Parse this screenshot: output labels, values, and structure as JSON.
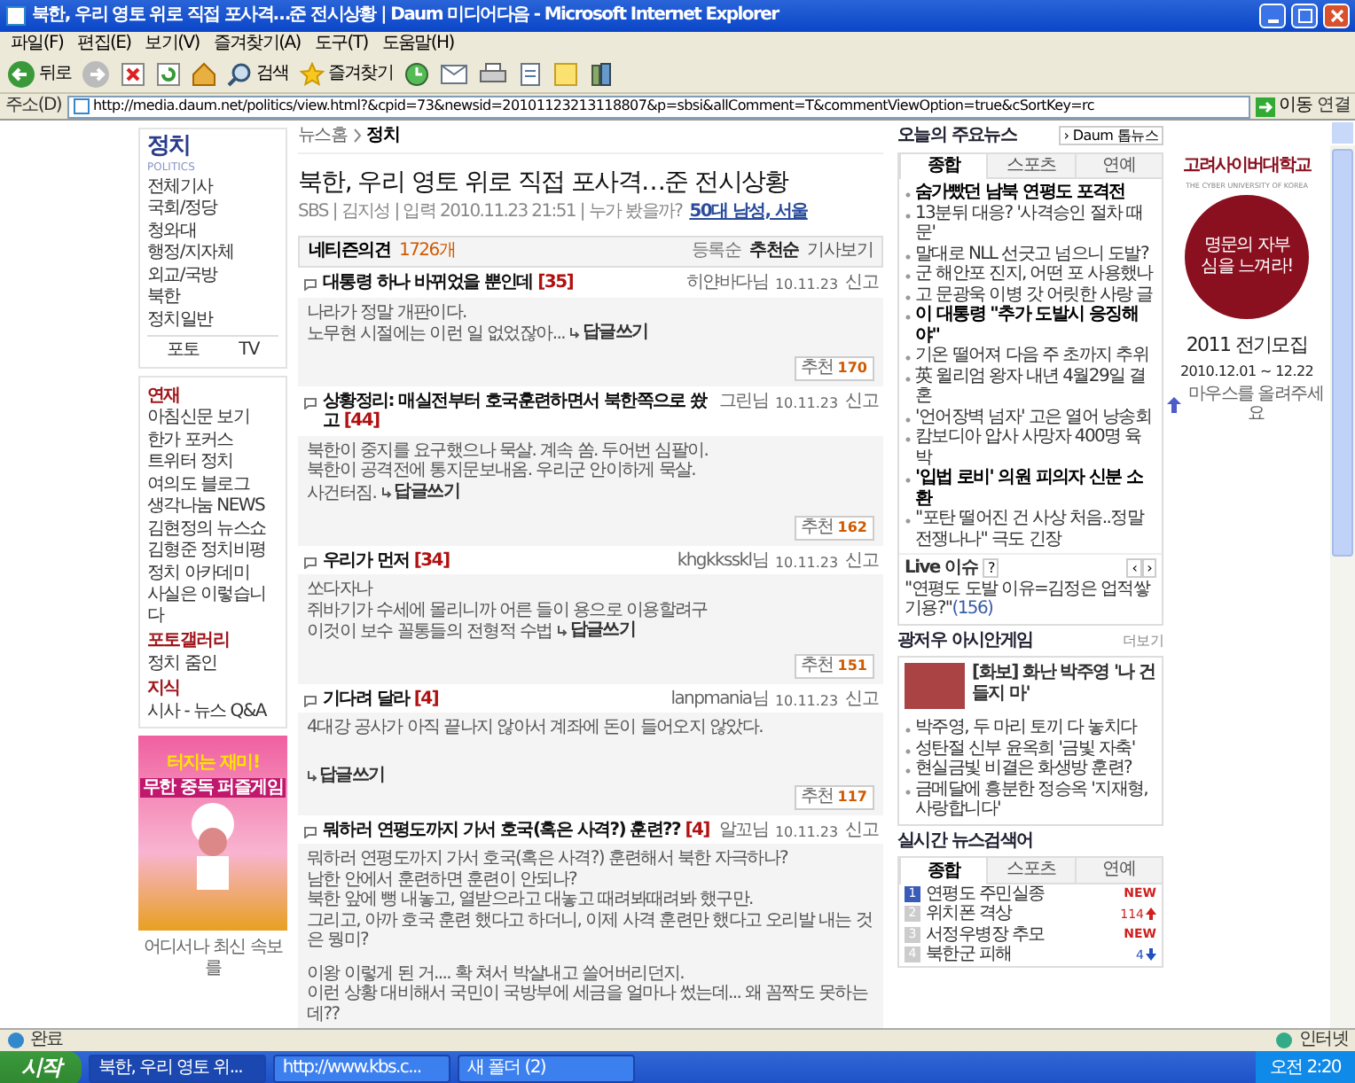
{
  "window": {
    "title": "북한, 우리 영토 위로 직접 포사격…준 전시상황 | Daum 미디어다음 - Microsoft Internet Explorer"
  },
  "menu": [
    "파일(F)",
    "편집(E)",
    "보기(V)",
    "즐겨찾기(A)",
    "도구(T)",
    "도움말(H)"
  ],
  "toolbar": {
    "back": "뒤로",
    "search": "검색",
    "favorites": "즐겨찾기"
  },
  "address": {
    "label": "주소(D)",
    "url": "http://media.daum.net/politics/view.html?&cpid=73&newsid=20101123213118807&p=sbsi&allComment=T&commentViewOption=true&cSortKey=rc",
    "go": "이동",
    "links": "연결"
  },
  "sidebar": {
    "title": "정치",
    "subtitle": "POLITICS",
    "items": [
      "전체기사",
      "국회/정당",
      "청와대",
      "행정/지자체",
      "외교/국방",
      "북한",
      "정치일반"
    ],
    "tabs": [
      {
        "label": "포토",
        "selected": false
      },
      {
        "label": "TV",
        "selected": false
      }
    ],
    "groups": [
      {
        "heading": "연재",
        "items": [
          "아침신문 보기",
          "한가 포커스",
          "트위터 정치",
          "여의도 블로그",
          "생각나눔 NEWS",
          "김현정의 뉴스쇼",
          "김형준 정치비평",
          "정치 아카데미",
          "사실은 이렇습니다"
        ]
      },
      {
        "heading": "포토갤러리",
        "items": [
          "정치 줌인"
        ]
      },
      {
        "heading": "지식",
        "items": [
          "시사 - 뉴스 Q&A"
        ]
      }
    ],
    "ad": {
      "headline": "터지는 재미!",
      "subline": "무한 중독 퍼즐게임"
    },
    "mobile": "어디서나 최신 속보를"
  },
  "article": {
    "breadcrumb": [
      "뉴스홈",
      "정치"
    ],
    "title": "북한, 우리 영토 위로 직접 포사격…준 전시상황",
    "meta": "SBS | 김지성 | 입력 2010.11.23 21:51 | 누가 봤을까?",
    "meta_link": "50대 남성, 서울"
  },
  "comments_header": {
    "label": "네티즌의견",
    "count": "1726개",
    "sorts": [
      {
        "label": "등록순",
        "selected": false
      },
      {
        "label": "추천순",
        "selected": true
      }
    ],
    "link": "기사보기"
  },
  "comments": [
    {
      "title": "대통령 하나 바뀌었을 뿐인데",
      "replies": "[35]",
      "author": "히얀바다님",
      "date": "10.11.23",
      "report": "신고",
      "body": [
        [
          "나라가 정말 개판이다.",
          "노무현 시절에는 이런 일 없었잖아..."
        ]
      ],
      "reply_link": "답글쓰기",
      "reply_own_line": false,
      "recommend_label": "추천",
      "recommend": "170"
    },
    {
      "title": "상황정리: 매실전부터 호국훈련하면서 북한쪽으로 쐈고",
      "replies": "[44]",
      "author": "그린님",
      "date": "10.11.23",
      "report": "신고",
      "body": [
        [
          "북한이 중지를 요구했으나 묵살. 계속 쏨. 두어번 심팔이.",
          "북한이 공격전에 통지문보내옴. 우리군 안이하게 묵살.",
          "사건터짐."
        ]
      ],
      "reply_link": "답글쓰기",
      "reply_own_line": false,
      "recommend_label": "추천",
      "recommend": "162"
    },
    {
      "title": "우리가 먼저",
      "replies": "[34]",
      "author": "khgkksskl님",
      "date": "10.11.23",
      "report": "신고",
      "body": [
        [
          "쏘다자나",
          "쥐바기가 수세에 몰리니까 어른 들이 용으로 이용할려구",
          "이것이 보수 꼴통들의 전형적 수법"
        ]
      ],
      "reply_link": "답글쓰기",
      "reply_own_line": false,
      "recommend_label": "추천",
      "recommend": "151"
    },
    {
      "title": "기다려 달라",
      "replies": "[4]",
      "author": "lanpmania님",
      "date": "10.11.23",
      "report": "신고",
      "body": [
        [
          "4대강 공사가 아직 끝나지 않아서 계좌에 돈이 들어오지 않았다."
        ]
      ],
      "reply_link": "답글쓰기",
      "reply_own_line": true,
      "recommend_label": "추천",
      "recommend": "117"
    },
    {
      "title": "뭐하러 연평도까지 가서 호국(혹은 사격?) 훈련??",
      "replies": "[4]",
      "author": "알꼬님",
      "date": "10.11.23",
      "report": "신고",
      "body": [
        [
          "뭐하러 연평도까지 가서 호국(혹은 사격?) 훈련해서 북한 자극하나?",
          "남한 안에서 훈련하면 훈련이 안되나?",
          "북한 앞에 뻥 내놓고, 열받으라고 대놓고 때려봐때려봐 했구만.",
          "그리고, 아까 호국 훈련 했다고 하더니, 이제 사격 훈련만 했다고 오리발 내는 것은 뭥미?"
        ],
        [
          "이왕 이렇게 된 거.... 확 쳐서 박살내고 쓸어버리던지.",
          "이런 상황 대비해서 국민이 국방부에 세금을 얼마나 썼는데... 왜 꼼짝도 못하는데??"
        ]
      ]
    }
  ],
  "top_news": {
    "title": "오늘의 주요뉴스",
    "button": "› Daum 톱뉴스",
    "tabs": [
      {
        "label": "종합",
        "selected": true
      },
      {
        "label": "스포츠",
        "selected": false
      },
      {
        "label": "연예",
        "selected": false
      }
    ],
    "items": [
      {
        "text": "숨가빴던 남북 연평도 포격전",
        "bold": true
      },
      {
        "text": "13분뒤 대응? '사격승인 절차 때문'",
        "bold": false
      },
      {
        "text": "말대로 NLL 선긋고 넘으니 도발?",
        "bold": false
      },
      {
        "text": "군 해안포 진지, 어떤 포 사용했나",
        "bold": false
      },
      {
        "text": "고 문광욱 이병 갓 어릿한 사랑 글",
        "bold": false
      },
      {
        "text": "이 대통령 \"추가 도발시 응징해야\"",
        "bold": true
      },
      {
        "text": "기온 떨어져 다음 주 초까지 추위",
        "bold": false
      },
      {
        "text": "英 윌리엄 왕자 내년 4월29일 결혼",
        "bold": false
      },
      {
        "text": "'언어장벽 넘자' 고은 열어 낭송회",
        "bold": false
      },
      {
        "text": "캄보디아 압사 사망자 400명 육박",
        "bold": false
      },
      {
        "text": "'입법 로비' 의원 피의자 신분 소환",
        "bold": true
      },
      {
        "text": "\"포탄 떨어진 건 사상 처음..정말 전쟁나나\" 극도 긴장",
        "bold": false
      }
    ],
    "live": {
      "label": "Live 이슈",
      "help": "?",
      "prev": "‹",
      "next": "›",
      "text": "\"연평도 도발 이유=김정은 업적쌓기용?\"",
      "count": "(156)"
    }
  },
  "photo_news": {
    "title": "광저우 아시안게임",
    "more": "더보기",
    "caption": "[화보] 화난 박주영 '나 건들지 마'",
    "items": [
      "박주영, 두 마리 토끼 다 놓치다",
      "성탄절 신부 윤옥희 '금빛 자축'",
      "현실금빛 비결은 화생방 훈련?",
      "금메달에 흥분한 정승옥 '지재형, 사랑합니다'"
    ]
  },
  "trending": {
    "title": "실시간 뉴스검색어",
    "tabs": [
      {
        "label": "종합",
        "selected": true
      },
      {
        "label": "스포츠",
        "selected": false
      },
      {
        "label": "연예",
        "selected": false
      }
    ],
    "items": [
      {
        "rank": "1",
        "text": "연평도 주민실종",
        "kind": "new",
        "mark": "NEW",
        "selected": true
      },
      {
        "rank": "2",
        "text": "위치폰 격상",
        "kind": "up",
        "mark": "114",
        "selected": false
      },
      {
        "rank": "3",
        "text": "서정우병장 추모",
        "kind": "new",
        "mark": "NEW",
        "selected": false
      },
      {
        "rank": "4",
        "text": "북한군 피해",
        "kind": "down",
        "mark": "4",
        "selected": false
      }
    ]
  },
  "ad": {
    "school": "고려사이버대학교",
    "english": "THE CYBER UNIVERSITY OF KOREA",
    "slogan": "명문의 자부심을 느껴라!",
    "recruit": "2011 전기모집",
    "dates": "2010.12.01 ~ 12.22",
    "hint": "마우스를 올려주세요"
  },
  "status_bar": {
    "text": "완료",
    "zone": "인터넷"
  },
  "taskbar": {
    "start": "시작",
    "tasks": [
      {
        "label": "북한, 우리 영토 위...",
        "selected": true
      },
      {
        "label": "http://www.kbs.c...",
        "selected": false
      },
      {
        "label": "새 폴더 (2)",
        "selected": false
      }
    ],
    "clock": "오전 2:20"
  }
}
